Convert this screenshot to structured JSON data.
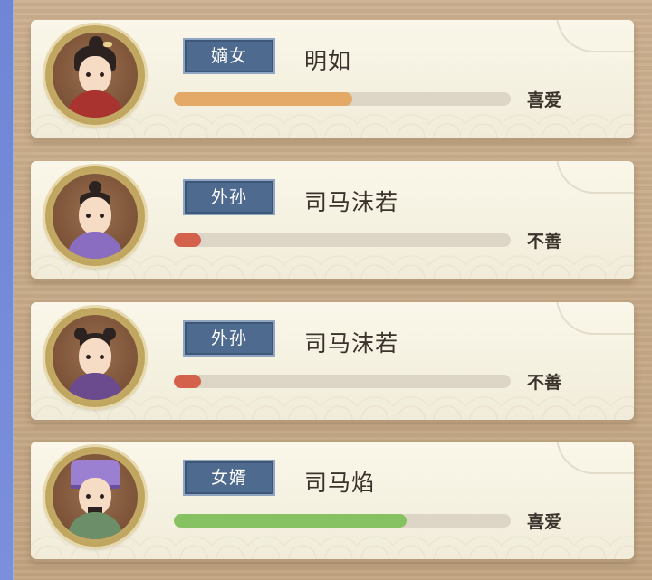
{
  "relatives": [
    {
      "relation": "嫡女",
      "name": "明如",
      "affection_level": "喜爱",
      "affection_fraction": 0.53,
      "bar_color": "#e4a867",
      "avatar": "portrait-girl-hair-ornament"
    },
    {
      "relation": "外孙",
      "name": "司马沫若",
      "affection_level": "不善",
      "affection_fraction": 0.08,
      "bar_color": "#d4614c",
      "avatar": "portrait-boy-topknot"
    },
    {
      "relation": "外孙",
      "name": "司马沫若",
      "affection_level": "不善",
      "affection_fraction": 0.08,
      "bar_color": "#d4614c",
      "avatar": "portrait-boy-double-buns"
    },
    {
      "relation": "女婿",
      "name": "司马焰",
      "affection_level": "喜爱",
      "affection_fraction": 0.69,
      "bar_color": "#86c262",
      "avatar": "portrait-man-purple-hat"
    }
  ]
}
